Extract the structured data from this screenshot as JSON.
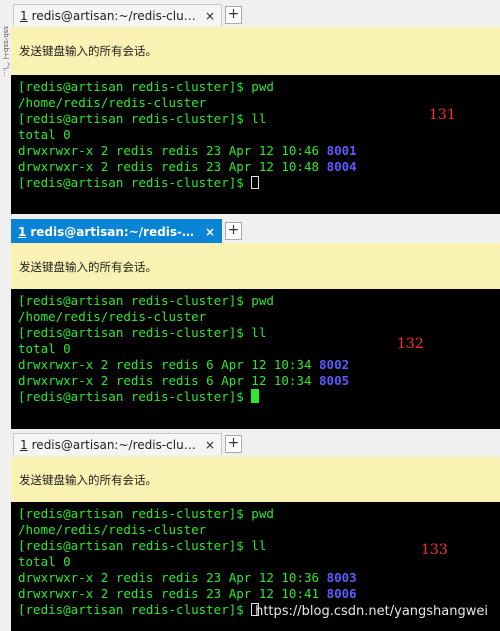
{
  "left_strip": {
    "text": "ssb-ssb上 ^\\…"
  },
  "panels": [
    {
      "tab": {
        "number": "1",
        "title": "redis@artisan:~/redis-cluster",
        "close": "×",
        "active": false
      },
      "add_button": "+",
      "notice": "发送键盘输入的所有会话。",
      "label": "131",
      "lines": [
        {
          "text": "[redis@artisan redis-cluster]$ pwd"
        },
        {
          "text": "/home/redis/redis-cluster"
        },
        {
          "text": "[redis@artisan redis-cluster]$ ll"
        },
        {
          "text": "total 0"
        },
        {
          "text": "drwxrwxr-x 2 redis redis 23 Apr 12 10:46 ",
          "dir": "8001"
        },
        {
          "text": "drwxrwxr-x 2 redis redis 23 Apr 12 10:48 ",
          "dir": "8004"
        },
        {
          "text": "[redis@artisan redis-cluster]$ "
        }
      ]
    },
    {
      "tab": {
        "number": "1",
        "title": "redis@artisan:~/redis-clust...",
        "close": "×",
        "active": true
      },
      "add_button": "+",
      "notice": "发送键盘输入的所有会话。",
      "label": "132",
      "lines": [
        {
          "text": "[redis@artisan redis-cluster]$ pwd"
        },
        {
          "text": "/home/redis/redis-cluster"
        },
        {
          "text": "[redis@artisan redis-cluster]$ ll"
        },
        {
          "text": "total 0"
        },
        {
          "text": "drwxrwxr-x 2 redis redis 6 Apr 12 10:34 ",
          "dir": "8002"
        },
        {
          "text": "drwxrwxr-x 2 redis redis 6 Apr 12 10:34 ",
          "dir": "8005"
        },
        {
          "text": "[redis@artisan redis-cluster]$ "
        }
      ]
    },
    {
      "tab": {
        "number": "1",
        "title": "redis@artisan:~/redis-cluster",
        "close": "×",
        "active": false
      },
      "add_button": "+",
      "notice": "发送键盘输入的所有会话。",
      "label": "133",
      "lines": [
        {
          "text": "[redis@artisan redis-cluster]$ pwd"
        },
        {
          "text": "/home/redis/redis-cluster"
        },
        {
          "text": "[redis@artisan redis-cluster]$ ll"
        },
        {
          "text": "total 0"
        },
        {
          "text": "drwxrwxr-x 2 redis redis 23 Apr 12 10:36 ",
          "dir": "8003"
        },
        {
          "text": "drwxrwxr-x 2 redis redis 23 Apr 12 10:41 ",
          "dir": "8006"
        },
        {
          "text": "[redis@artisan redis-cluster]$ "
        }
      ]
    }
  ],
  "watermark": "https://blog.csdn.net/yangshangwei"
}
